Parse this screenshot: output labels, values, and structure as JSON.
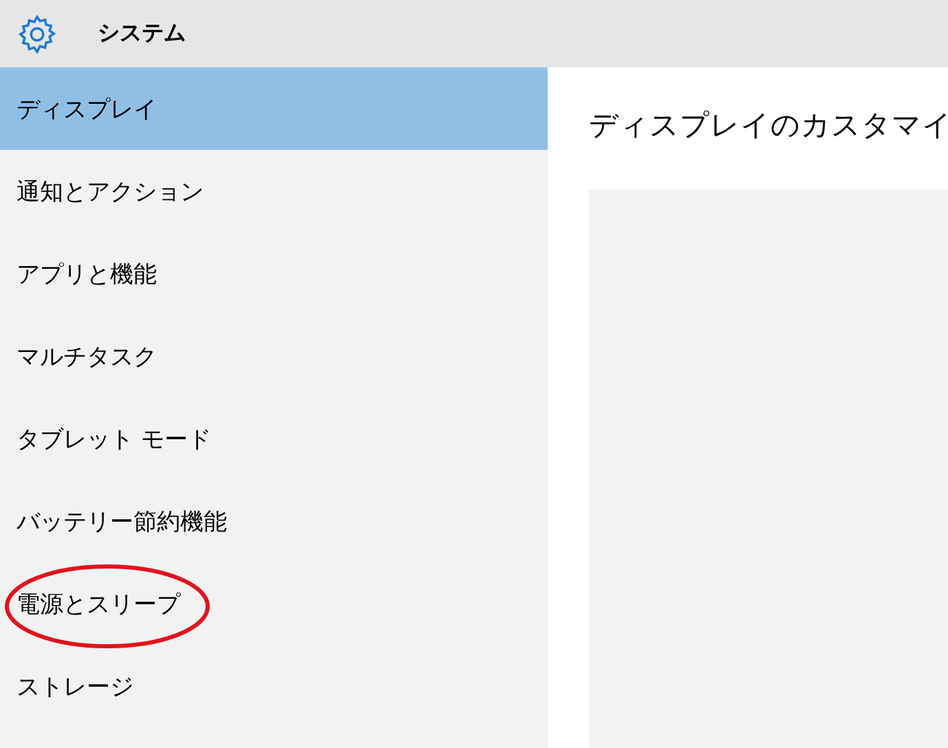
{
  "header": {
    "title": "システム"
  },
  "sidebar": {
    "items": [
      {
        "label": "ディスプレイ",
        "selected": true,
        "highlighted": false
      },
      {
        "label": "通知とアクション",
        "selected": false,
        "highlighted": false
      },
      {
        "label": "アプリと機能",
        "selected": false,
        "highlighted": false
      },
      {
        "label": "マルチタスク",
        "selected": false,
        "highlighted": false
      },
      {
        "label": "タブレット モード",
        "selected": false,
        "highlighted": false
      },
      {
        "label": "バッテリー節約機能",
        "selected": false,
        "highlighted": false
      },
      {
        "label": "電源とスリープ",
        "selected": false,
        "highlighted": true
      },
      {
        "label": "ストレージ",
        "selected": false,
        "highlighted": false
      }
    ]
  },
  "content": {
    "heading": "ディスプレイのカスタマイ"
  }
}
